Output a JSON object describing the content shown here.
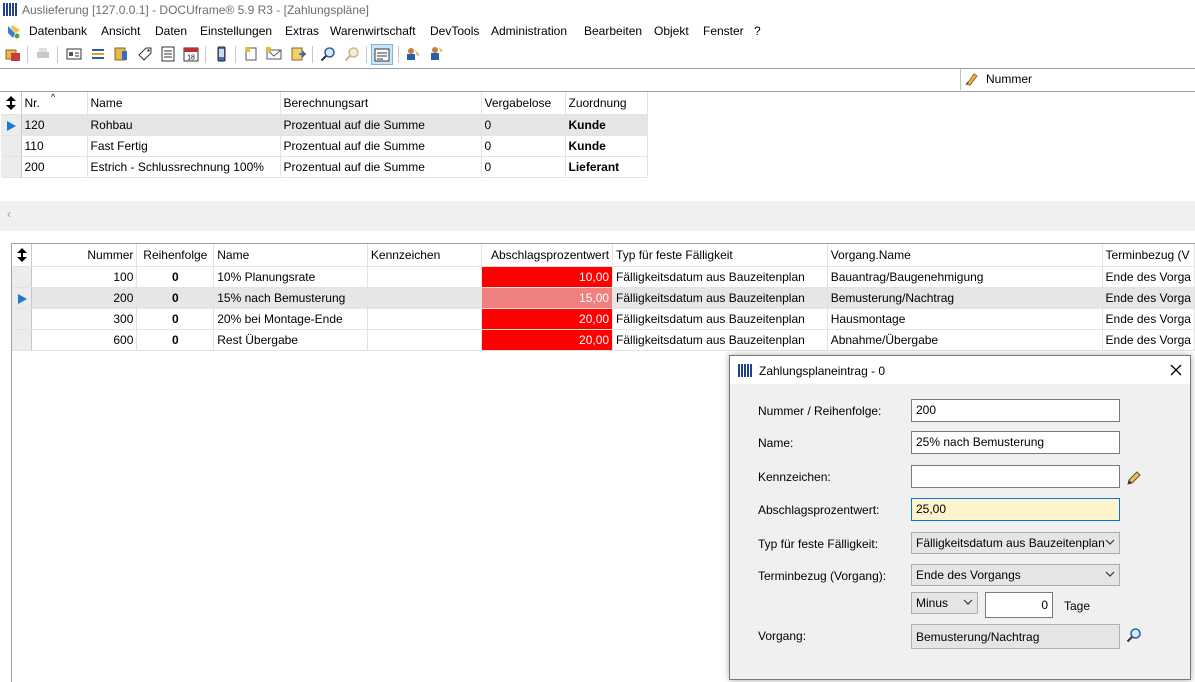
{
  "window": {
    "title": "Auslieferung [127.0.0.1] - DOCUframe® 5.9 R3 - [Zahlungspläne]"
  },
  "menu": [
    "Datenbank",
    "Ansicht",
    "Daten",
    "Einstellungen",
    "Extras",
    "Warenwirtschaft",
    "DevTools",
    "Administration",
    "Bearbeiten",
    "Objekt",
    "Fenster",
    "?"
  ],
  "sort_field": "Nummer",
  "upper_grid": {
    "columns": [
      "Nr.",
      "Name",
      "Berechnungsart",
      "Vergabelose",
      "Zuordnung"
    ],
    "rows": [
      [
        "120",
        "Rohbau",
        "Prozentual auf die Summe",
        "0",
        "Kunde"
      ],
      [
        "110",
        "Fast Fertig",
        "Prozentual auf die Summe",
        "0",
        "Kunde"
      ],
      [
        "200",
        "Estrich - Schlussrechnung 100%",
        "Prozentual auf die Summe",
        "0",
        "Lieferant"
      ]
    ],
    "selected_row": 0
  },
  "lower_grid": {
    "columns": [
      "Nummer",
      "Reihenfolge",
      "Name",
      "Kennzeichen",
      "Abschlagsprozentwert",
      "Typ für feste Fälligkeit",
      "Vorgang.Name",
      "Terminbezug (V"
    ],
    "rows": [
      [
        "100",
        "0",
        "10% Planungsrate",
        "",
        "10,00",
        "Fälligkeitsdatum aus Bauzeitenplan",
        "Bauantrag/Baugenehmigung",
        "Ende des Vorga"
      ],
      [
        "200",
        "0",
        "15% nach Bemusterung",
        "",
        "15,00",
        "Fälligkeitsdatum aus Bauzeitenplan",
        "Bemusterung/Nachtrag",
        "Ende des Vorga"
      ],
      [
        "300",
        "0",
        "20% bei Montage-Ende",
        "",
        "20,00",
        "Fälligkeitsdatum aus Bauzeitenplan",
        "Hausmontage",
        "Ende des Vorga"
      ],
      [
        "600",
        "0",
        "Rest Übergabe",
        "",
        "20,00",
        "Fälligkeitsdatum aus Bauzeitenplan",
        "Abnahme/Übergabe",
        "Ende des Vorga"
      ]
    ],
    "selected_row": 1
  },
  "dialog": {
    "title": "Zahlungsplaneintrag - 0",
    "labels": {
      "nummer": "Nummer / Reihenfolge:",
      "name": "Name:",
      "kennzeichen": "Kennzeichen:",
      "abschlag": "Abschlagsprozentwert:",
      "typ": "Typ für feste Fälligkeit:",
      "terminbezug": "Terminbezug (Vorgang):",
      "tage": "Tage",
      "vorgang": "Vorgang:"
    },
    "values": {
      "nummer": "200",
      "name": "25% nach Bemusterung",
      "kennzeichen": "",
      "abschlag": "25,00",
      "typ": "Fälligkeitsdatum aus Bauzeitenplan",
      "terminbezug": "Ende des Vorgangs",
      "vorzeichen": "Minus",
      "tage": "0",
      "vorgang": "Bemusterung/Nachtrag"
    }
  },
  "colors": {
    "highlight_red": "#ff0000",
    "highlight_pink": "#f08080",
    "active_field": "#fff3cd",
    "selection_arrow": "#1e78d6"
  }
}
